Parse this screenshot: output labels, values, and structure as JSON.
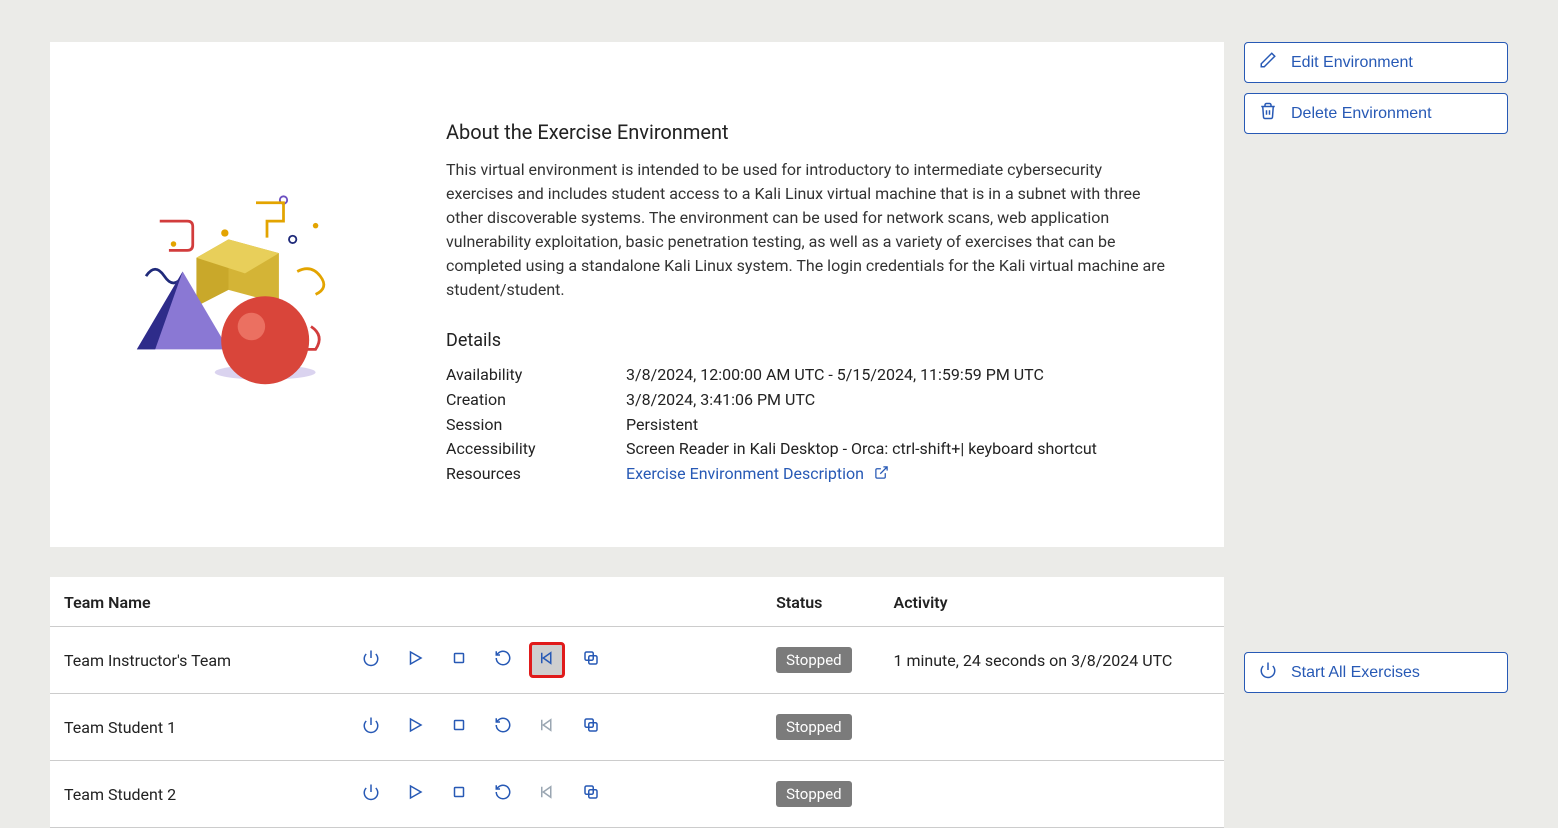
{
  "about": {
    "heading": "About the Exercise Environment",
    "description": "This virtual environment is intended to be used for introductory to intermediate cybersecurity exercises and includes student access to a Kali Linux virtual machine that is in a subnet with three other discoverable systems. The environment can be used for network scans, web application vulnerability exploitation, basic penetration testing, as well as a variety of exercises that can be completed using a standalone Kali Linux system. The login credentials for the Kali virtual machine are student/student."
  },
  "details": {
    "heading": "Details",
    "rows": {
      "availability": {
        "label": "Availability",
        "value": "3/8/2024, 12:00:00 AM UTC - 5/15/2024, 11:59:59 PM UTC"
      },
      "creation": {
        "label": "Creation",
        "value": "3/8/2024, 3:41:06 PM UTC"
      },
      "session": {
        "label": "Session",
        "value": "Persistent"
      },
      "accessibility": {
        "label": "Accessibility",
        "value": "Screen Reader in Kali Desktop - Orca: ctrl-shift+| keyboard shortcut"
      },
      "resources": {
        "label": "Resources",
        "link_text": "Exercise Environment Description"
      }
    }
  },
  "side_actions": {
    "edit": "Edit Environment",
    "delete": "Delete Environment",
    "start_all": "Start All Exercises"
  },
  "table": {
    "headers": {
      "team": "Team Name",
      "status": "Status",
      "activity": "Activity"
    },
    "rows": [
      {
        "team": "Team Instructor's Team",
        "status": "Stopped",
        "activity": "1 minute, 24 seconds on 3/8/2024 UTC",
        "reset_enabled": true,
        "highlighted": true
      },
      {
        "team": "Team Student 1",
        "status": "Stopped",
        "activity": "",
        "reset_enabled": false,
        "highlighted": false
      },
      {
        "team": "Team Student 2",
        "status": "Stopped",
        "activity": "",
        "reset_enabled": false,
        "highlighted": false
      }
    ]
  }
}
